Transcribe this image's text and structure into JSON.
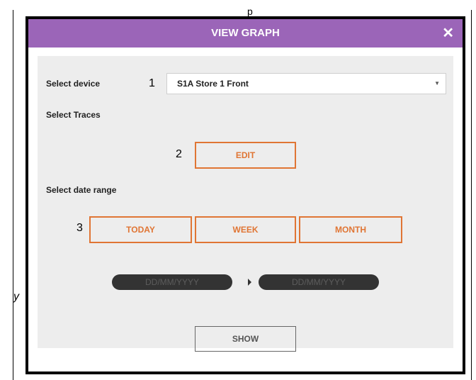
{
  "page": {
    "top_fragment": "p",
    "side_fragment": "y"
  },
  "modal": {
    "title": "VIEW GRAPH",
    "close_symbol": "✕",
    "colors": {
      "header": "#9b65b8",
      "accent": "#e07534",
      "body": "#ededed"
    }
  },
  "device": {
    "label": "Select device",
    "marker": "1",
    "selected": "S1A Store 1 Front",
    "arrow": "▼"
  },
  "traces": {
    "label": "Select Traces",
    "marker": "2",
    "edit_label": "EDIT"
  },
  "date_range": {
    "label": "Select date range",
    "marker": "3",
    "buttons": [
      "TODAY",
      "WEEK",
      "MONTH"
    ],
    "from_placeholder": "DD/MM/YYYY",
    "to_placeholder": "DD/MM/YYYY"
  },
  "show_label": "SHOW"
}
